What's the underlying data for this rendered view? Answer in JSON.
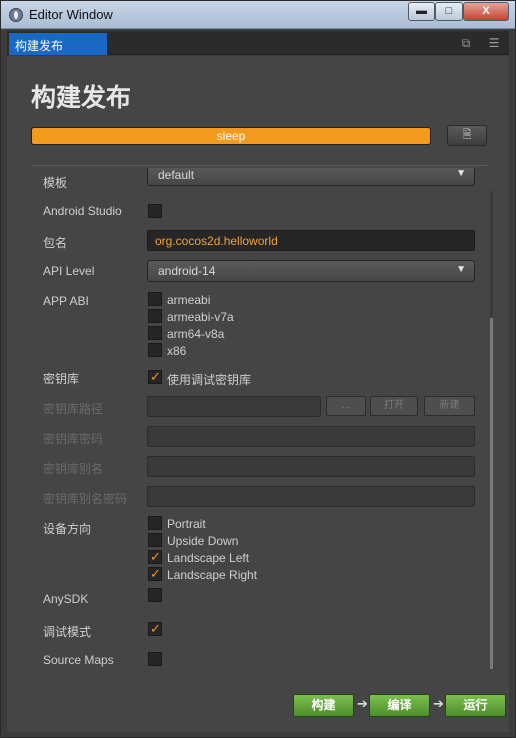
{
  "window": {
    "title": "Editor Window",
    "min_label": "▬",
    "max_label": "□",
    "close_label": "X"
  },
  "tabbar": {
    "tab_label": "构建发布",
    "restore_icon": "⧉",
    "menu_icon": "☰"
  },
  "header": {
    "title": "构建发布",
    "progress": {
      "value": 1.0,
      "label": "sleep"
    },
    "doc_icon": "🗎"
  },
  "form": {
    "template": {
      "label": "模板",
      "value": "default"
    },
    "android_studio": {
      "label": "Android Studio",
      "checked": false
    },
    "package_name": {
      "label": "包名",
      "value": "org.cocos2d.helloworld"
    },
    "api_level": {
      "label": "API Level",
      "value": "android-14"
    },
    "app_abi": {
      "label": "APP ABI",
      "options": [
        {
          "label": "armeabi",
          "checked": false
        },
        {
          "label": "armeabi-v7a",
          "checked": false
        },
        {
          "label": "arm64-v8a",
          "checked": false
        },
        {
          "label": "x86",
          "checked": false
        }
      ]
    },
    "keystore": {
      "label": "密钥库",
      "option_label": "使用调试密钥库",
      "checked": true
    },
    "keystore_path": {
      "label": "密钥库路径",
      "browse_label": "...",
      "open_label": "打开",
      "new_label": "新建"
    },
    "keystore_password": {
      "label": "密钥库密码"
    },
    "keystore_alias": {
      "label": "密钥库别名"
    },
    "keystore_alias_password": {
      "label": "密钥库别名密码"
    },
    "orientation": {
      "label": "设备方向",
      "options": [
        {
          "label": "Portrait",
          "checked": false
        },
        {
          "label": "Upside Down",
          "checked": false
        },
        {
          "label": "Landscape Left",
          "checked": true
        },
        {
          "label": "Landscape Right",
          "checked": true
        }
      ]
    },
    "anysdk": {
      "label": "AnySDK",
      "checked": false
    },
    "debug_mode": {
      "label": "调试模式",
      "checked": true
    },
    "source_maps": {
      "label": "Source Maps",
      "checked": false
    }
  },
  "actions": {
    "build_label": "构建",
    "compile_label": "编译",
    "run_label": "运行",
    "arrow": "➔"
  },
  "colors": {
    "accent": "#f39a1e",
    "tab_active": "#1868c4",
    "action_green": "#5ea436"
  }
}
